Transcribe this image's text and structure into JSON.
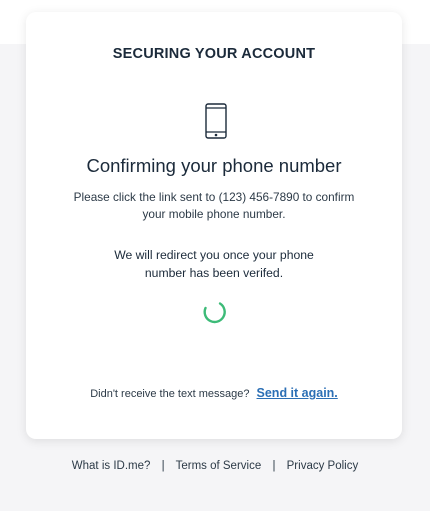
{
  "card": {
    "heading": "SECURING YOUR ACCOUNT",
    "icon": "mobile-phone-icon",
    "title": "Confirming your phone number",
    "description": "Please click the link sent to (123) 456-7890 to confirm your mobile phone number.",
    "redirect_message": "We will redirect you once your phone number has been verifed.",
    "spinner": "loading-spinner",
    "resend_prompt": "Didn't receive the text message?",
    "resend_link": "Send it again."
  },
  "footer": {
    "links": [
      "What is ID.me?",
      "Terms of Service",
      "Privacy Policy"
    ],
    "separator": "|"
  },
  "colors": {
    "accent": "#2b6fb5",
    "spinner": "#3dbb78",
    "text": "#1b2a3a",
    "background": "#f5f5f7"
  }
}
